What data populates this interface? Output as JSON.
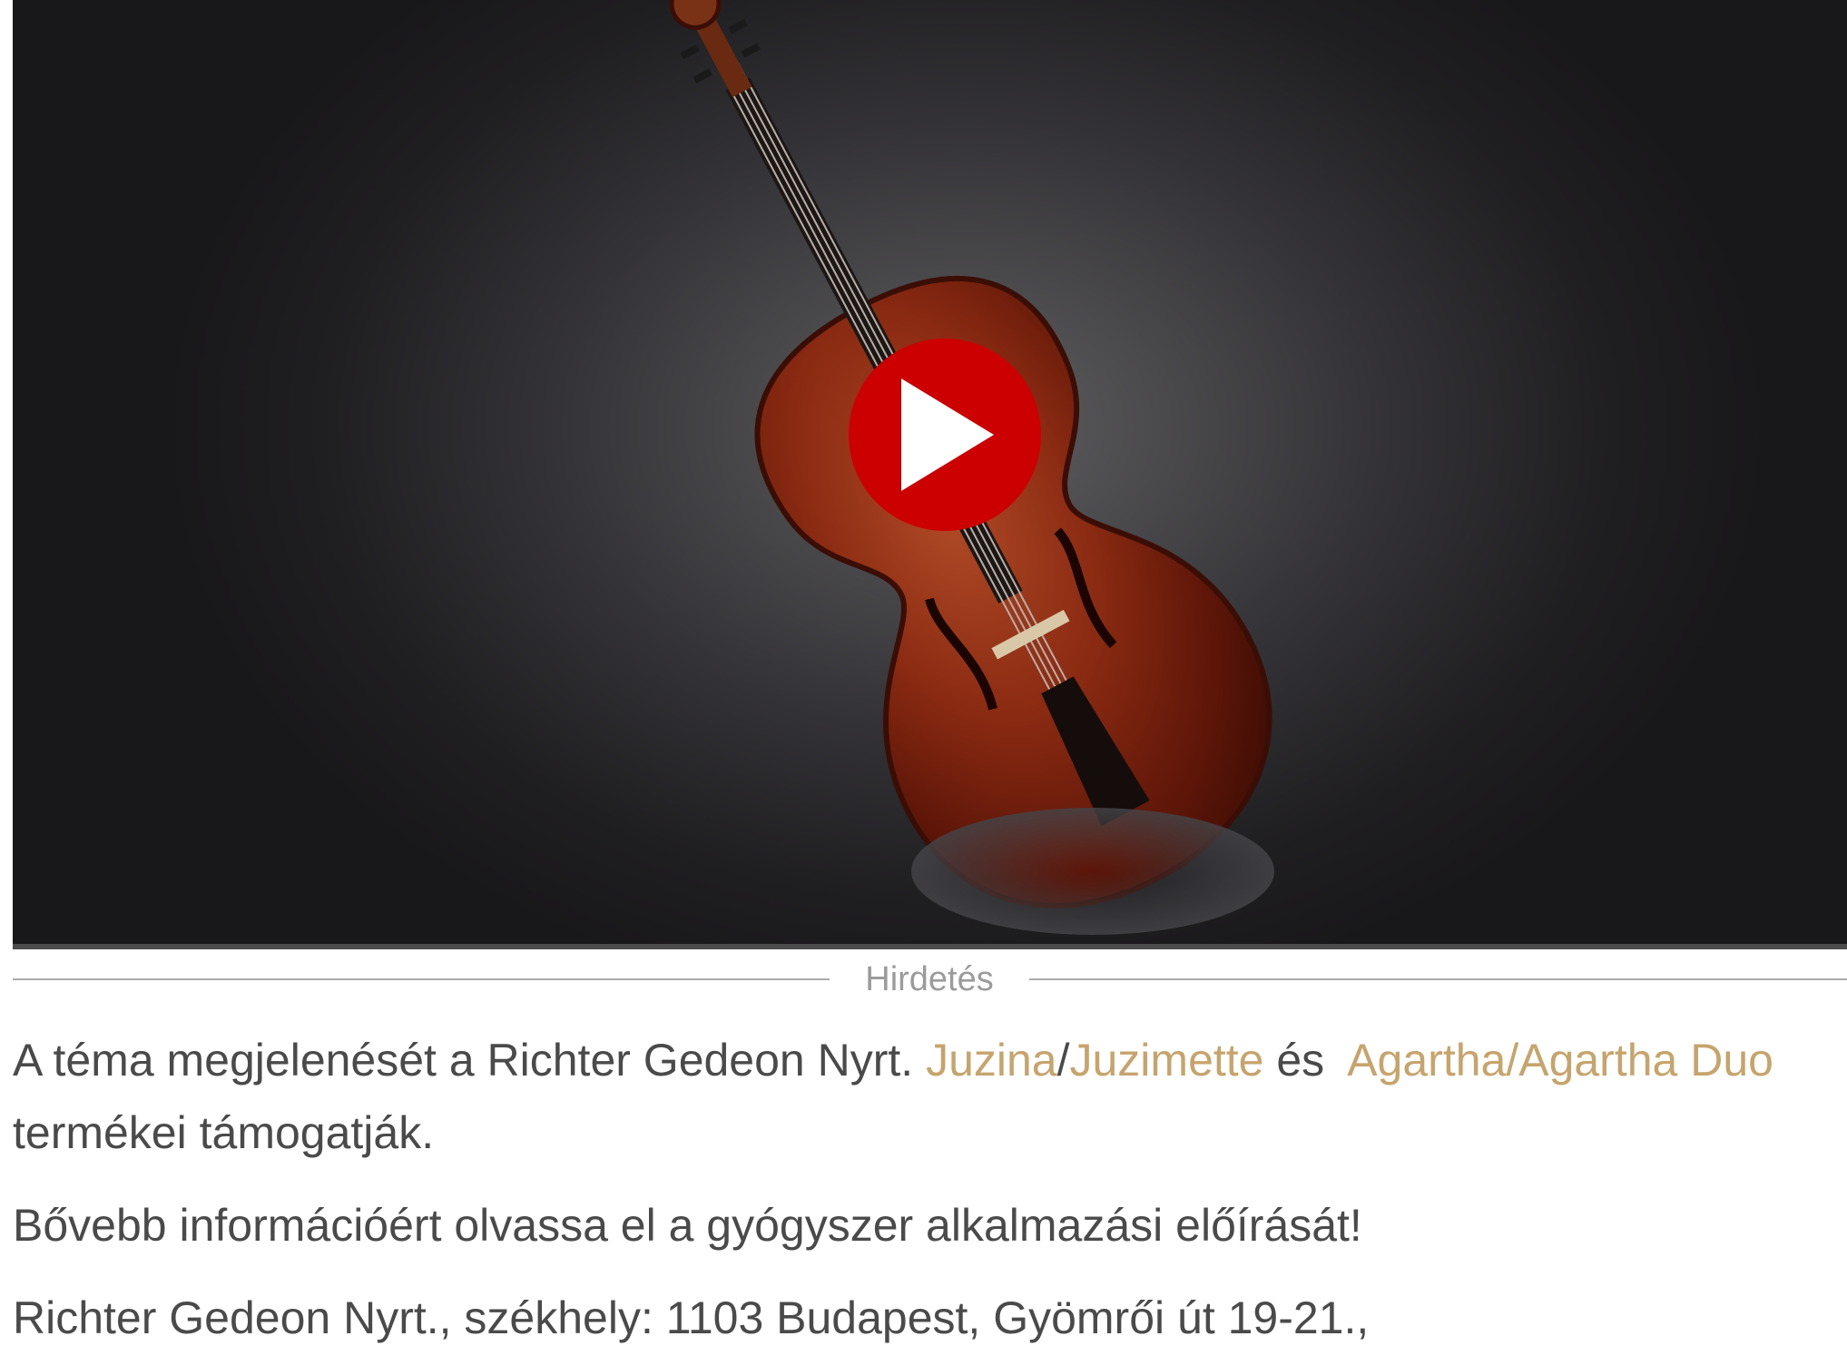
{
  "video": {
    "thumbnail_icon": "cello-image",
    "play_icon": "play-icon",
    "play_button_color": "#cc0000"
  },
  "ad": {
    "label": "Hirdetés"
  },
  "sponsor": {
    "text_before": "A téma megjelenését a Richter Gedeon Nyrt. ",
    "link_juzina": "Juzina",
    "slash": "/",
    "link_juzimette": "Juzimette",
    "text_and": " és  ",
    "link_agartha": "Agartha/Agartha Duo",
    "text_after": " termékei támogatják."
  },
  "info": {
    "text": "Bővebb információért olvassa el a gyógyszer alkalmazási előírását!"
  },
  "company": {
    "text": "Richter Gedeon Nyrt., székhely: 1103 Budapest, Gyömrői út 19-21.,"
  },
  "colors": {
    "link": "#c7a46b",
    "body_text": "#4a4a4a",
    "ad_label": "#9b9b9b"
  }
}
